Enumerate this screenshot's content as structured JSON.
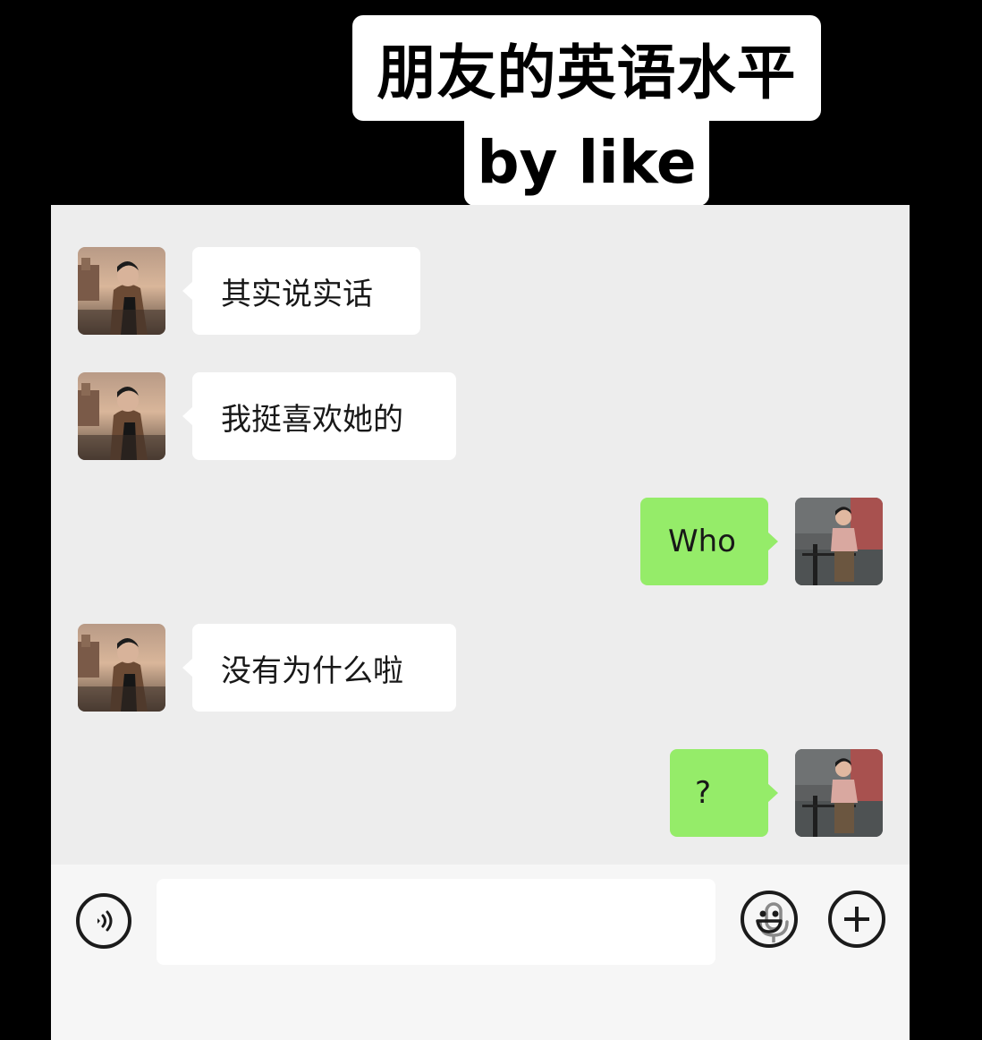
{
  "caption": {
    "line1": "朋友的英语水平",
    "line2": "by like"
  },
  "messages": [
    {
      "side": "in",
      "text": "其实说实话"
    },
    {
      "side": "in",
      "text": "我挺喜欢她的"
    },
    {
      "side": "out",
      "text": "Who"
    },
    {
      "side": "in",
      "text": "没有为什么啦"
    },
    {
      "side": "out",
      "text": "?"
    }
  ],
  "input_bar": {
    "voice_icon": "voice-mode-icon",
    "mic_icon": "microphone-icon",
    "emoji_icon": "emoji-icon",
    "plus_icon": "plus-icon",
    "text_value": ""
  },
  "colors": {
    "chat_background": "#ededed",
    "incoming_bubble": "#ffffff",
    "outgoing_bubble": "#95ec69",
    "input_bar": "#f6f6f6"
  }
}
